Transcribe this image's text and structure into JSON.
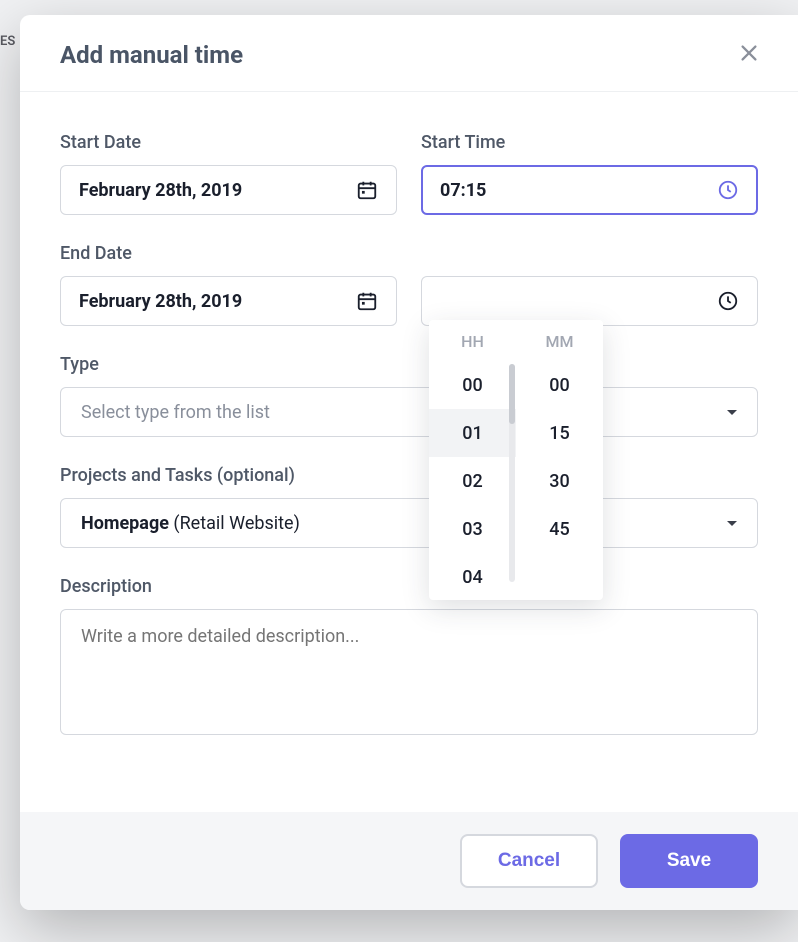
{
  "backdrop": {
    "es_fragment": "ES"
  },
  "modal": {
    "title": "Add manual time",
    "start_date": {
      "label": "Start Date",
      "value": "February 28th, 2019"
    },
    "start_time": {
      "label": "Start Time",
      "value": "07:15"
    },
    "end_date": {
      "label": "End Date",
      "value": "February 28th, 2019"
    },
    "type": {
      "label": "Type",
      "placeholder": "Select type from the list"
    },
    "projects": {
      "label": "Projects and Tasks (optional)",
      "value_bold": "Homepage ",
      "value_rest": "(Retail Website)"
    },
    "description": {
      "label": "Description",
      "placeholder": "Write a more detailed description..."
    },
    "footer": {
      "cancel": "Cancel",
      "save": "Save"
    }
  },
  "time_picker": {
    "hh_label": "HH",
    "mm_label": "MM",
    "hours": [
      "00",
      "01",
      "02",
      "03",
      "04"
    ],
    "hours_selected_index": 1,
    "minutes": [
      "00",
      "15",
      "30",
      "45"
    ]
  }
}
